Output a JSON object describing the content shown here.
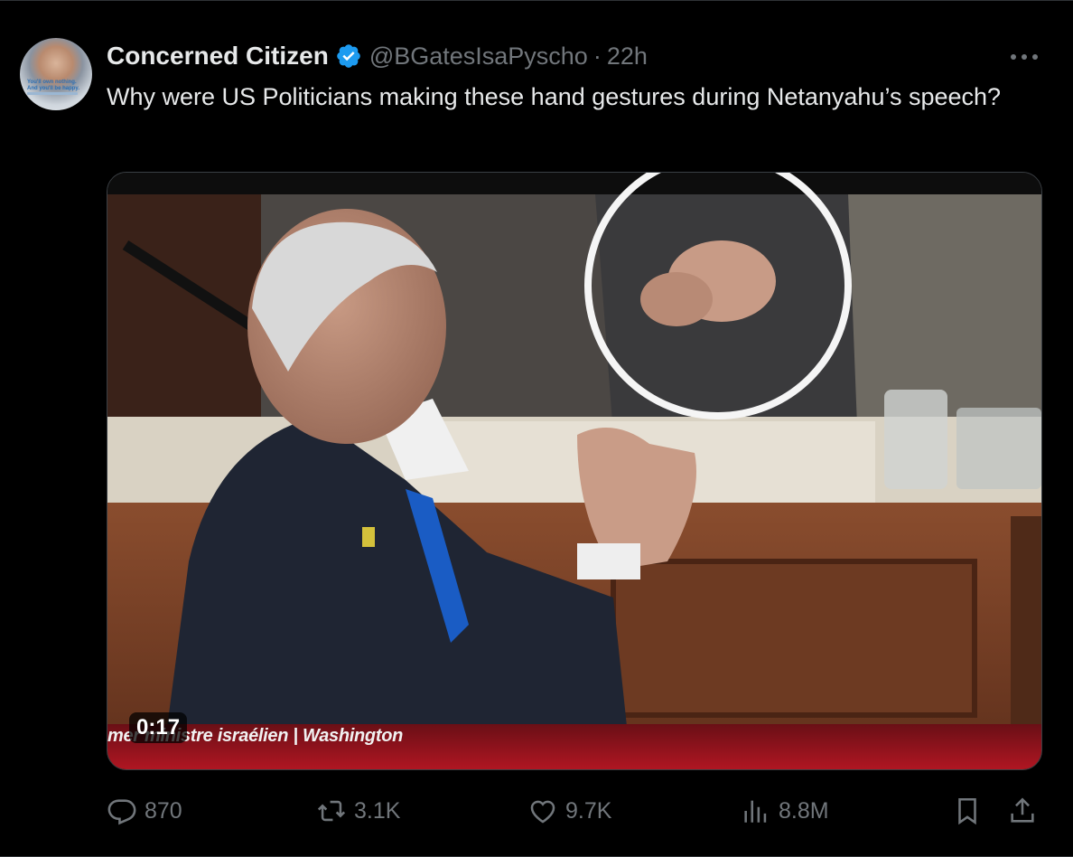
{
  "tweet": {
    "display_name": "Concerned Citizen",
    "handle": "@BGatesIsaPyscho",
    "separator": "·",
    "time": "22h",
    "text": "Why were US Politicians making these hand gestures during Netanyahu’s speech?",
    "avatar_text": "You'll own nothing. And you'll be happy."
  },
  "media": {
    "duration": "0:17",
    "caption": "mer ministre israélien | Washington"
  },
  "actions": {
    "replies": "870",
    "reposts": "3.1K",
    "likes": "9.7K",
    "views": "8.8M"
  },
  "colors": {
    "background": "#000000",
    "text_primary": "#e7e9ea",
    "text_secondary": "#71767b",
    "verified": "#1d9bf0",
    "border": "#2f3336"
  },
  "icons": [
    "verified-badge-icon",
    "more-icon",
    "reply-icon",
    "repost-icon",
    "like-icon",
    "views-icon",
    "bookmark-icon",
    "share-icon"
  ]
}
